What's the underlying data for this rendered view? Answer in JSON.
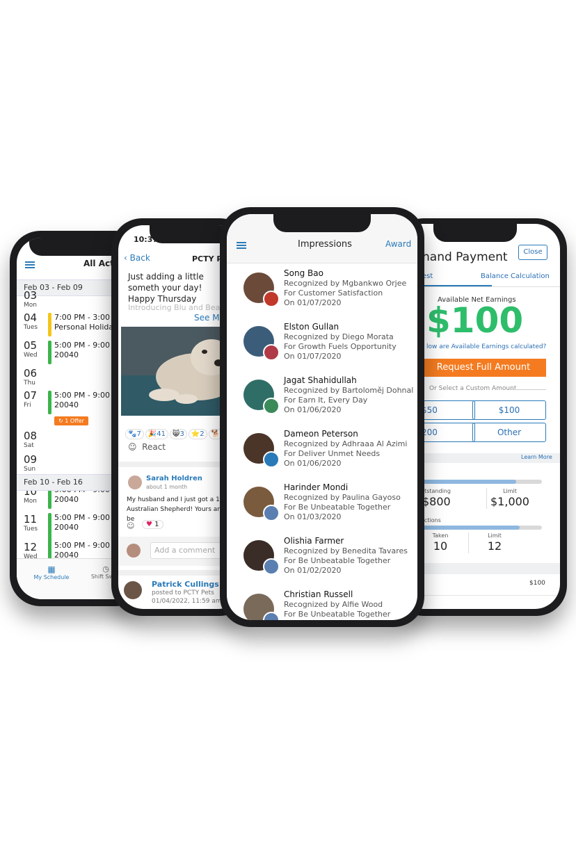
{
  "phone1": {
    "title": "All Activ",
    "week1": "Feb 03 - Feb 09",
    "week2": "Feb 10 - Feb 16",
    "days": [
      {
        "num": "03",
        "dow": "Mon"
      },
      {
        "num": "04",
        "dow": "Tues"
      },
      {
        "num": "05",
        "dow": "Wed"
      },
      {
        "num": "06",
        "dow": "Thu"
      },
      {
        "num": "07",
        "dow": "Fri"
      },
      {
        "num": "08",
        "dow": "Sat"
      },
      {
        "num": "09",
        "dow": "Sun"
      },
      {
        "num": "10",
        "dow": "Mon"
      },
      {
        "num": "11",
        "dow": "Tues"
      },
      {
        "num": "12",
        "dow": "Wed"
      }
    ],
    "events": [
      {
        "time": "7:00 PM - 3:00 A",
        "sub": "Personal Holiday",
        "color": "#f5c518"
      },
      {
        "time": "5:00 PM - 9:00 A",
        "sub": "20040",
        "color": "#3bb54a"
      },
      {
        "time": "5:00 PM - 9:00 A",
        "sub": "20040",
        "color": "#3bb54a"
      },
      {
        "time": "5:00 PM - 9:00 A",
        "sub": "20040",
        "color": "#3bb54a"
      },
      {
        "time": "5:00 PM - 9:00 A",
        "sub": "20040",
        "color": "#3bb54a"
      },
      {
        "time": "5:00 PM - 9:00 A",
        "sub": "20040",
        "color": "#3bb54a"
      }
    ],
    "offer": "1 Offer",
    "tabs": {
      "schedule": "My Schedule",
      "swap": "Shift Swap"
    }
  },
  "phone2": {
    "clock": "10:37",
    "back": "Back",
    "title": "PCTY Pet",
    "post_text": "Just adding a little someth your day! Happy Thursday",
    "post_faded": "Introducing Blu and Bean",
    "see_more": "See Mor",
    "reactions": [
      {
        "emoji": "🐾",
        "count": "7"
      },
      {
        "emoji": "🎉",
        "count": "41"
      },
      {
        "emoji": "😸",
        "count": "3"
      },
      {
        "emoji": "⭐",
        "count": "2"
      },
      {
        "emoji": "🐕",
        "count": ""
      }
    ],
    "react": "React",
    "comment_name": "Sarah Holdren",
    "comment_time": "about 1 month",
    "comment_text": "My husband and I just got a 10 w Australian Shepherd! Yours are be",
    "comment_heart": "1",
    "add_comment": "Add a comment",
    "post2_name": "Patrick Cullings",
    "post2_sub": "posted to PCTY Pets",
    "post2_time": "01/04/2022, 11:59 am |"
  },
  "phone3": {
    "title": "Impressions",
    "award": "Award",
    "items": [
      {
        "name": "Song Bao",
        "by": "Recognized by Mgbankwo Orjee",
        "for": "For Customer Satisfaction",
        "on": "On 01/07/2020",
        "av": "#6b4a3a",
        "badge": "#c0392b"
      },
      {
        "name": "Elston Gullan",
        "by": "Recognized by Diego Morata",
        "for": "For Growth Fuels Opportunity",
        "on": "On 01/07/2020",
        "av": "#3b5d7a",
        "badge": "#b03a48"
      },
      {
        "name": "Jagat Shahidullah",
        "by": "Recognized by Bartoloměj Dohnal",
        "for": "For Earn It, Every Day",
        "on": "On 01/06/2020",
        "av": "#2f6e66",
        "badge": "#3b8a5a"
      },
      {
        "name": "Dameon Peterson",
        "by": "Recognized by Adhraaa Al Azimi",
        "for": "For Deliver Unmet Needs",
        "on": "On 01/06/2020",
        "av": "#4a3528",
        "badge": "#2a7ab9"
      },
      {
        "name": "Harinder Mondi",
        "by": "Recognized by Paulina Gayoso",
        "for": "For Be Unbeatable Together",
        "on": "On 01/03/2020",
        "av": "#7a5b3e",
        "badge": "#5a7fb0"
      },
      {
        "name": "Olishia Farmer",
        "by": "Recognized by Benedita Tavares",
        "for": "For Be Unbeatable Together",
        "on": "On 01/02/2020",
        "av": "#3a2c26",
        "badge": "#5a7fb0"
      },
      {
        "name": "Christian Russell",
        "by": "Recognized by Alfie Wood",
        "for": "For Be Unbeatable Together",
        "on": "",
        "av": "#7a6a5a",
        "badge": "#5a7fb0"
      }
    ]
  },
  "phone4": {
    "title": "hand Payment",
    "close": "Close",
    "tab1": "est",
    "tab2": "Balance Calculation",
    "avail_label": "Available Net Earnings",
    "amount": "$100",
    "how_link": "low are Available Earnings calculated?",
    "request_full": "Request Full Amount",
    "or_select": "Or Select a Custom Amount",
    "btn_50": "$50",
    "btn_100": "$100",
    "btn_200": "200",
    "btn_other": "Other",
    "learn_more": "Learn More",
    "outstanding_label": "utstanding",
    "outstanding_val": "$800",
    "limit_label": "Limit",
    "limit_val": "$1,000",
    "actions_label": "actions",
    "taken_label": "Taken",
    "taken_val": "10",
    "limit2_label": "Limit",
    "limit2_val": "12",
    "section_y": "y",
    "row_val": "$100",
    "bar1_fraction": 0.8,
    "bar2_fraction": 0.83,
    "accent": "#2ebd6b",
    "orange": "#f47b20",
    "blue": "#2a7ab9"
  }
}
